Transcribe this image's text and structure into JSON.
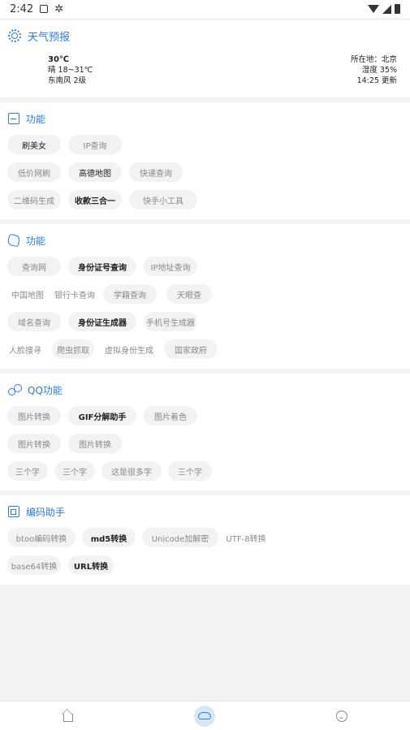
{
  "status_bar": {
    "time": "2:42"
  },
  "weather": {
    "title": "天气预报",
    "temperature": "30℃",
    "condition": "晴 18~31℃",
    "wind": "东南风 2级",
    "location": "所在地：北京",
    "humidity": "湿度 35%",
    "updated": "14:25 更新"
  },
  "sections": [
    {
      "title": "功能",
      "rows": [
        [
          {
            "label": "刷美女",
            "bold": true
          },
          {
            "label": "IP查询",
            "bold": false
          }
        ],
        [
          {
            "label": "低价网刷",
            "bold": false
          },
          {
            "label": "高德地图",
            "bold": true
          },
          {
            "label": "快递查询",
            "bold": false
          }
        ],
        [
          {
            "label": "二维码生成",
            "bold": false
          },
          {
            "label": "收款三合一",
            "bold": true
          },
          {
            "label": "快手小工具",
            "bold": false
          }
        ]
      ]
    },
    {
      "title": "功能",
      "rows": [
        [
          {
            "label": "查询网",
            "bold": false
          },
          {
            "label": "身份证号查询",
            "bold": true
          },
          {
            "label": "IP地址查询",
            "bold": false
          }
        ],
        [
          {
            "label": "中国地图",
            "bold": false
          },
          {
            "label": "银行卡查询",
            "bold": false
          },
          {
            "label": "学籍查询",
            "bold": false
          },
          {
            "label": "天眼查",
            "bold": false
          }
        ],
        [
          {
            "label": "域名查询",
            "bold": false
          },
          {
            "label": "身份证生成器",
            "bold": true
          },
          {
            "label": "手机号生成器",
            "bold": false
          }
        ],
        [
          {
            "label": "人脸搜寻",
            "bold": false
          },
          {
            "label": "爬虫抓取",
            "bold": false
          },
          {
            "label": "虚拟身份生成",
            "bold": false
          },
          {
            "label": "国家政府",
            "bold": false
          }
        ]
      ]
    },
    {
      "title": "QQ功能",
      "rows": [
        [
          {
            "label": "图片转换",
            "bold": false
          },
          {
            "label": "GIF分解助手",
            "bold": true
          },
          {
            "label": "图片着色",
            "bold": false
          }
        ],
        [
          {
            "label": "图片转换",
            "bold": false
          },
          {
            "label": "图片转换",
            "bold": false
          }
        ],
        [
          {
            "label": "三个字",
            "bold": false
          },
          {
            "label": "三个字",
            "bold": false
          },
          {
            "label": "这是很多字",
            "bold": false
          },
          {
            "label": "三个字",
            "bold": false
          }
        ]
      ]
    },
    {
      "title": "编码助手",
      "rows": [
        [
          {
            "label": "btoo编码转换",
            "bold": false
          },
          {
            "label": "md5转换",
            "bold": true
          },
          {
            "label": "Unicode加解密",
            "bold": false
          },
          {
            "label": "UTF-8转换",
            "bold": false
          }
        ],
        [
          {
            "label": "base64转换",
            "bold": false
          },
          {
            "label": "URL转换",
            "bold": true
          }
        ]
      ]
    }
  ],
  "colors": {
    "accent": "#2b7de0",
    "chip_bg": "#f2f2f2",
    "muted_text": "#888888"
  },
  "icons": {
    "weather": "sun-icon",
    "section_0": "image-icon",
    "section_1": "puzzle-icon",
    "section_2": "qq-icon",
    "section_3": "code-icon",
    "nav": [
      "home-icon",
      "cloud-icon",
      "smile-icon"
    ]
  }
}
